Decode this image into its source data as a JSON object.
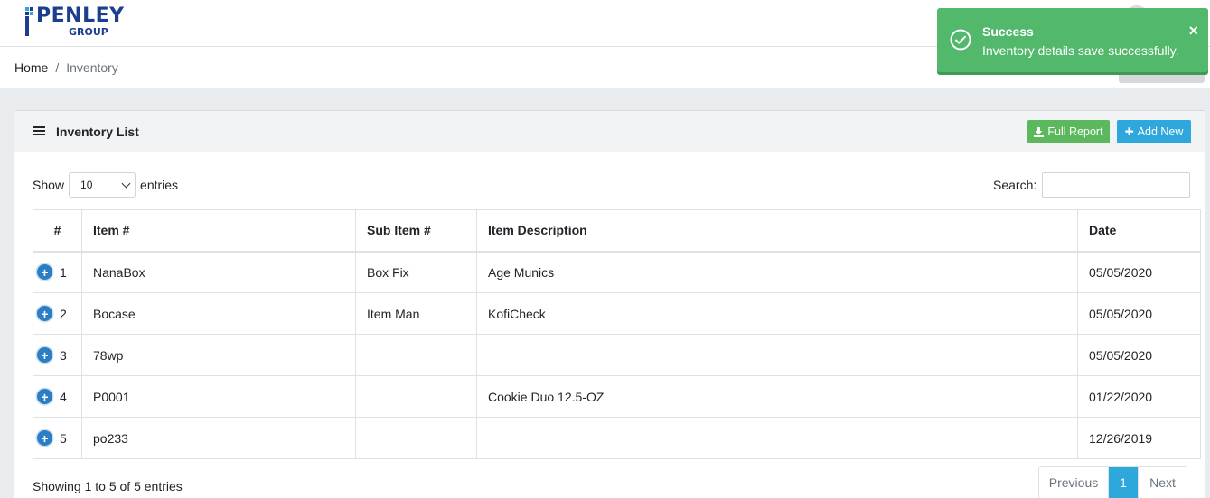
{
  "brand": {
    "name": "PENLEY",
    "sub": "GROUP"
  },
  "breadcrumb": {
    "home": "Home",
    "separator": "/",
    "current": "Inventory"
  },
  "card": {
    "title": "Inventory List",
    "full_report_label": "Full Report",
    "add_new_label": "Add New"
  },
  "controls": {
    "show_label": "Show",
    "entries_value": "10",
    "entries_label": "entries",
    "search_label": "Search:",
    "search_value": ""
  },
  "table": {
    "headers": [
      "#",
      "Item #",
      "Sub Item #",
      "Item Description",
      "Date"
    ],
    "rows": [
      {
        "num": "1",
        "item": "NanaBox",
        "sub_item": "Box Fix",
        "description": "Age Munics",
        "date": "05/05/2020"
      },
      {
        "num": "2",
        "item": "Bocase",
        "sub_item": "Item Man",
        "description": "KofiCheck",
        "date": "05/05/2020"
      },
      {
        "num": "3",
        "item": "78wp",
        "sub_item": "",
        "description": "",
        "date": "05/05/2020"
      },
      {
        "num": "4",
        "item": "P0001",
        "sub_item": "",
        "description": "Cookie Duo 12.5-OZ",
        "date": "01/22/2020"
      },
      {
        "num": "5",
        "item": "po233",
        "sub_item": "",
        "description": "",
        "date": "12/26/2019"
      }
    ]
  },
  "footer": {
    "info": "Showing 1 to 5 of 5 entries",
    "previous": "Previous",
    "page": "1",
    "next": "Next"
  },
  "toast": {
    "title": "Success",
    "message": "Inventory details save successfully.",
    "close": "×"
  },
  "colors": {
    "success": "#51b86c",
    "primary": "#2ea8dc",
    "report": "#5cb85c",
    "brand": "#1b3f8c"
  }
}
